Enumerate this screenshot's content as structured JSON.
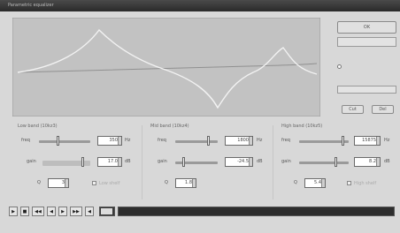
{
  "window": {
    "title": "Parametric equalizer"
  },
  "side_panel": {
    "ok_label": "OK",
    "small_button_1": "Cut",
    "small_button_2": "Del"
  },
  "bands": [
    {
      "title": "Low band (10kz3)",
      "freq_label": "freq",
      "freq_value": "350",
      "freq_unit": "Hz",
      "gain_label": "gain",
      "gain_value": "17.0",
      "gain_unit": "dB",
      "q_label": "Q",
      "q_value": "3",
      "toggle_label": "Low shelf"
    },
    {
      "title": "Mid band (10kz4)",
      "freq_label": "freq",
      "freq_value": "1800",
      "freq_unit": "Hz",
      "gain_label": "gain",
      "gain_value": "-24.5",
      "gain_unit": "dB",
      "q_label": "Q",
      "q_value": "1.8",
      "toggle_label": ""
    },
    {
      "title": "High band (10kz5)",
      "freq_label": "freq",
      "freq_value": "15875",
      "freq_unit": "Hz",
      "gain_label": "gain",
      "gain_value": "8.2",
      "gain_unit": "dB",
      "q_label": "Q",
      "q_value": "5.4",
      "toggle_label": "High shelf"
    }
  ],
  "transport": {
    "buttons": [
      "▶",
      "■",
      "◀◀",
      "◀",
      "▶",
      "▶▶",
      "◀"
    ]
  },
  "status": {
    "text": ""
  },
  "colors": {
    "graph_bg": "#c2c2c2",
    "curve": "#f2f2f2",
    "reference_curve": "#909090"
  }
}
